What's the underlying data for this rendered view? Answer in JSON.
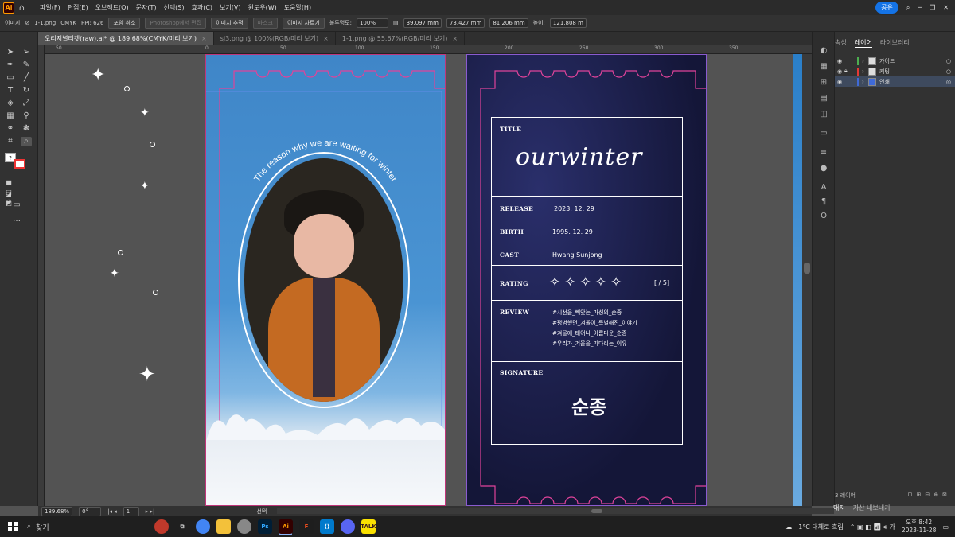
{
  "menubar": {
    "items": [
      "파일(F)",
      "편집(E)",
      "오브젝트(O)",
      "문자(T)",
      "선택(S)",
      "효과(C)",
      "보기(V)",
      "윈도우(W)",
      "도움말(H)"
    ],
    "share": "공유"
  },
  "control": {
    "label": "이미지",
    "file": "1-1.png",
    "mode": "CMYK",
    "ppi": "PPI: 626",
    "embed": "포함 취소",
    "ps_edit": "Photoshop에서 편집",
    "trace": "이미지 추적",
    "mask": "마스크",
    "crop": "이미지 자르기",
    "opacity_label": "불투명도:",
    "opacity_value": "100%",
    "x_value": "39.097 mm",
    "y_value": "73.427 mm",
    "w_value": "81.206 mm",
    "h_label": "높이:",
    "h_value": "121.808 m"
  },
  "tabs": [
    {
      "label": "오리지널티켓(raw).ai* @ 189.68%(CMYK/미리 보기)"
    },
    {
      "label": "sj3.png @ 100%(RGB/미리 보기)"
    },
    {
      "label": "1-1.png @ 55.67%(RGB/미리 보기)"
    }
  ],
  "ruler": [
    "50",
    "0",
    "50",
    "100",
    "150",
    "200",
    "250",
    "300",
    "350"
  ],
  "artboard1": {
    "curved_text": "The reason why we are waiting for winter"
  },
  "ticket": {
    "title_label": "TITLE",
    "title_script": "ourwinter",
    "release_label": "RELEASE",
    "release_value": "2023. 12. 29",
    "birth_label": "BIRTH",
    "birth_value": "1995. 12. 29",
    "cast_label": "CAST",
    "cast_value": "Hwang Sunjong",
    "rating_label": "RATING",
    "rating_suffix": "[ / 5]",
    "review_label": "REVIEW",
    "review_lines": [
      "#시선을_빼앗는_마성의_순종",
      "#평범했던_겨울이_특별해진_이야기",
      "#겨울에_태어나_아름다운_순종",
      "#우리가_겨울을_기다리는_이유"
    ],
    "signature_label": "SIGNATURE",
    "signature_value": "순종"
  },
  "panel": {
    "tabs": [
      "속성",
      "레이어",
      "라이브러리"
    ],
    "layers": [
      {
        "name": "가이드",
        "color": "#4caf50"
      },
      {
        "name": "커팅",
        "color": "#e53935"
      },
      {
        "name": "인쇄",
        "color": "#3f6ad8"
      }
    ],
    "footer": "3 레이어",
    "bottom_tabs": [
      "대지",
      "자산 내보내기"
    ]
  },
  "status": {
    "zoom": "189.68%",
    "angle": "0°",
    "page": "1",
    "tool": "선택"
  },
  "taskbar": {
    "search": "찾기",
    "weather": "1°C  대체로 흐림",
    "time": "오후 8:42",
    "date": "2023-11-28"
  }
}
